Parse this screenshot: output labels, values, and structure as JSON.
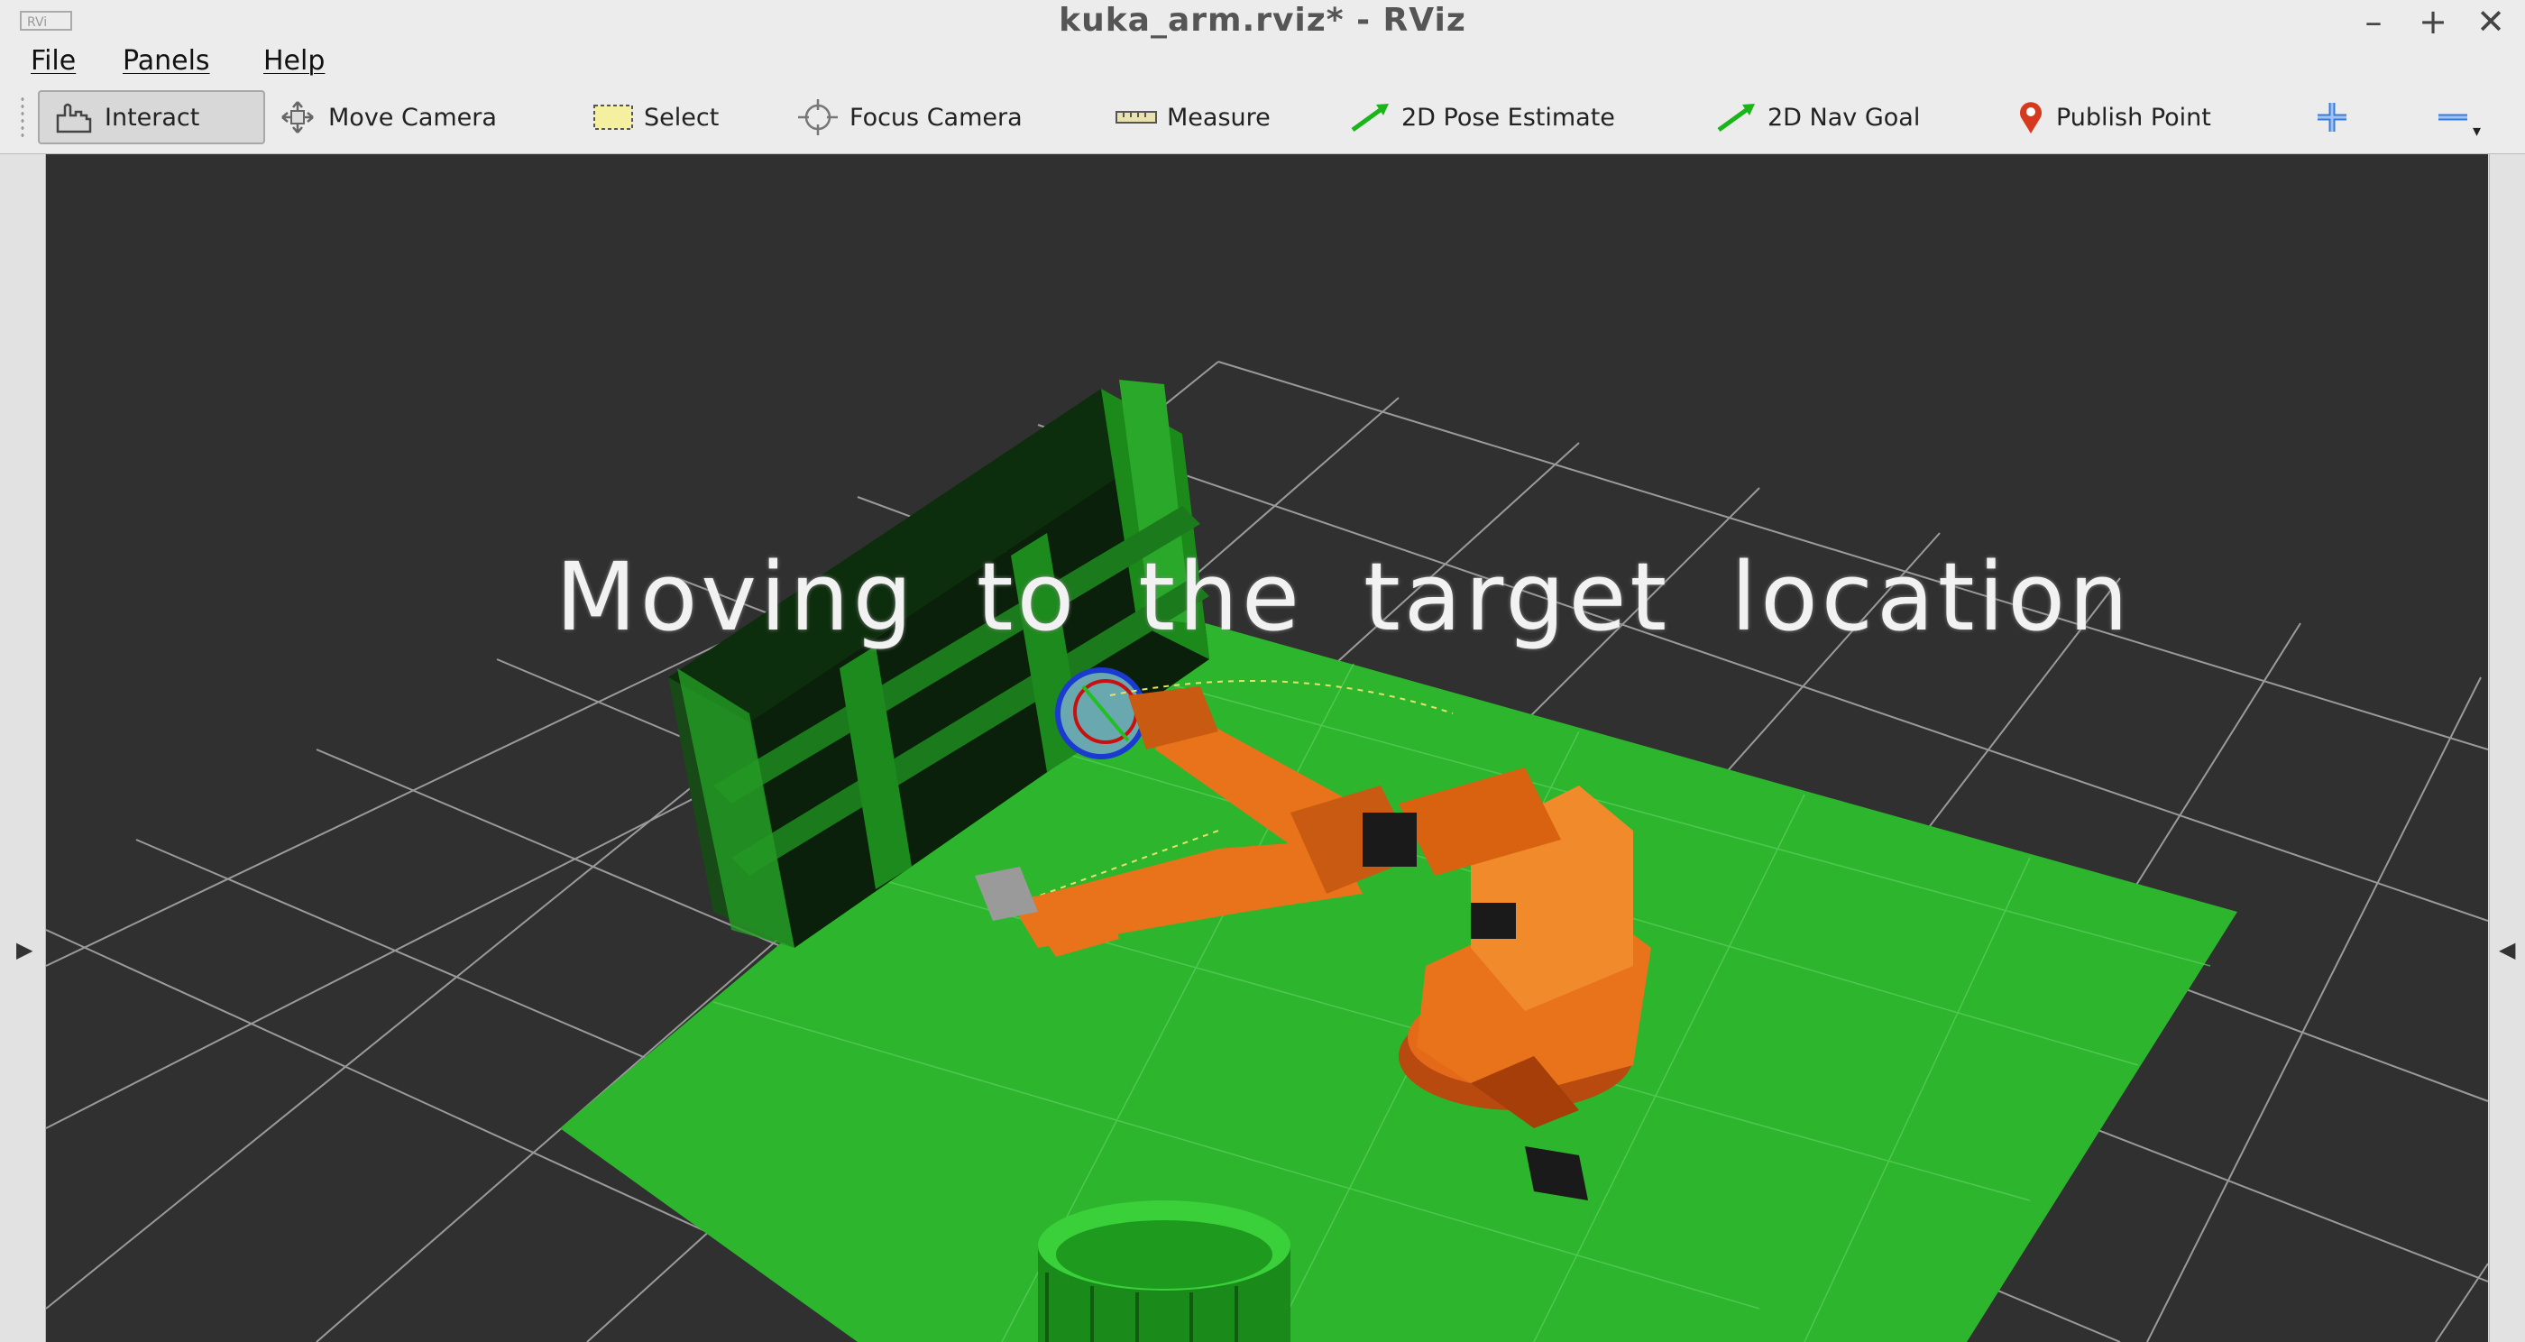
{
  "window": {
    "title": "kuka_arm.rviz* - RViz",
    "controls": [
      "minimize-icon",
      "maximize-icon",
      "close-icon"
    ]
  },
  "menu": {
    "items": [
      "File",
      "Panels",
      "Help"
    ]
  },
  "toolbar": {
    "tools": [
      {
        "label": "Interact",
        "icon": "hand-icon",
        "active": true
      },
      {
        "label": "Move Camera",
        "icon": "move-camera-icon",
        "active": false
      },
      {
        "label": "Select",
        "icon": "select-box-icon",
        "active": false
      },
      {
        "label": "Focus Camera",
        "icon": "focus-camera-icon",
        "active": false
      },
      {
        "label": "Measure",
        "icon": "ruler-icon",
        "active": false
      },
      {
        "label": "2D Pose Estimate",
        "icon": "green-arrow-icon",
        "active": false
      },
      {
        "label": "2D Nav Goal",
        "icon": "green-arrow-icon",
        "active": false
      },
      {
        "label": "Publish Point",
        "icon": "map-pin-icon",
        "active": false
      }
    ],
    "extra_icons": [
      "add-tool-icon",
      "remove-tool-icon"
    ]
  },
  "viewport": {
    "overlay_text": "Moving to the target location",
    "background_color": "#303030",
    "floor_color": "#2db52d",
    "robot_color": "#e8731a",
    "shelf_color": "#1f7a1f"
  }
}
